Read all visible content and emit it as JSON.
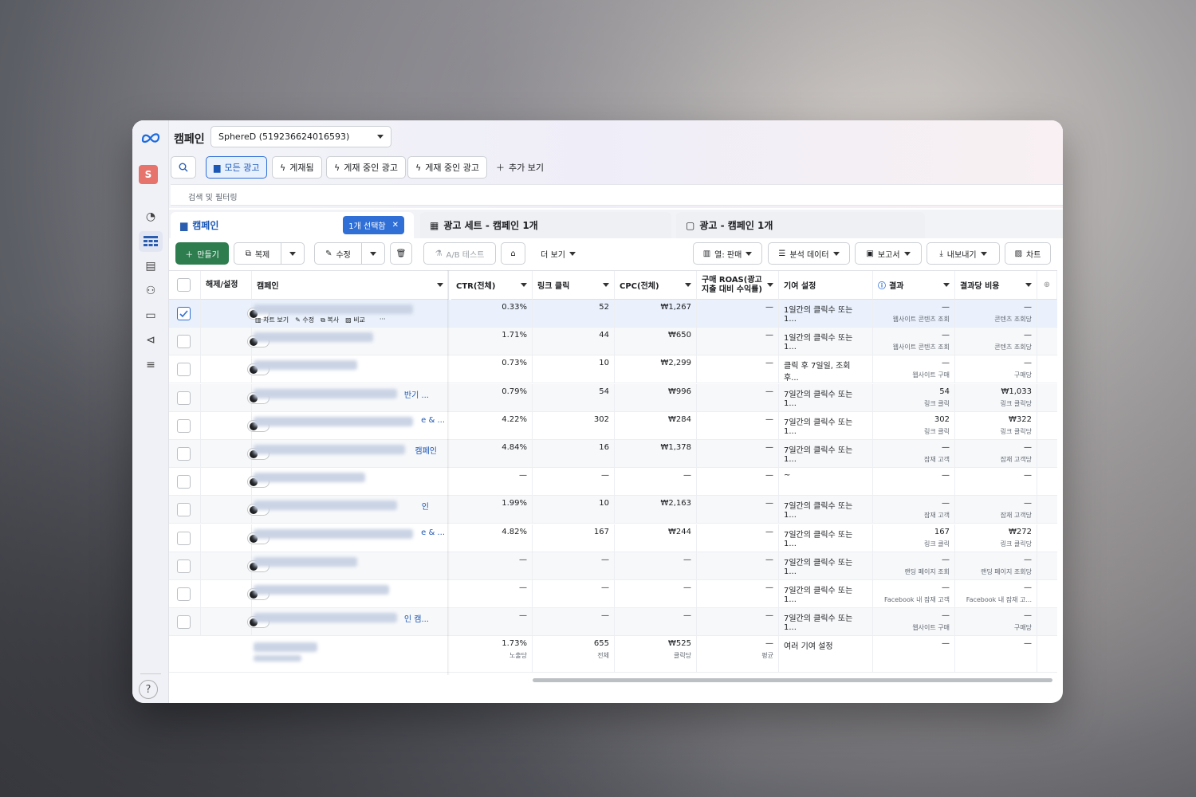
{
  "app": {
    "title": "캠페인",
    "account": "SphereD (519236624016593)",
    "avatar_letter": "S",
    "help": "?"
  },
  "filters": [
    {
      "label": "모든 광고",
      "active": true,
      "icon": "folder-icon"
    },
    {
      "label": "게재됨",
      "icon": "bolt-icon"
    },
    {
      "label": "게재 중인 광고",
      "icon": "bolt-icon"
    },
    {
      "label": "게재 중인 광고",
      "icon": "bolt-icon"
    },
    {
      "label": "추가 보기",
      "icon": "plus-icon"
    }
  ],
  "search_placeholder": "검색 및 필터링",
  "tabs": [
    {
      "label": "캠페인",
      "badge": "1개 선택함"
    },
    {
      "label": "광고 세트 - 캠페인 1개"
    },
    {
      "label": "광고 - 캠페인 1개"
    }
  ],
  "toolbar": {
    "create": "만들기",
    "duplicate": "복제",
    "edit": "수정",
    "ab_test": "A/B 테스트",
    "more": "더 보기",
    "columns": "열: 판매",
    "breakdown": "분석 데이터",
    "reports": "보고서",
    "export": "내보내기",
    "charts": "차트"
  },
  "columns": {
    "toggle": "해제/설정",
    "campaign": "캠페인",
    "ctr": "CTR(전체)",
    "link_clicks": "링크 클릭",
    "cpc": "CPC(전체)",
    "roas": "구매 ROAS(광고 지출 대비 수익률)",
    "attribution": "기여 설정",
    "results": "결과",
    "cost_per_result": "결과당 비용"
  },
  "row_actions": {
    "chart": "차트 보기",
    "edit": "수정",
    "duplicate": "복사",
    "compare": "비교",
    "more": "···"
  },
  "rows": [
    {
      "name_tail": "",
      "ctr": "0.33%",
      "clicks": "52",
      "cpc": "₩1,267",
      "roas": "—",
      "attr": "1일간의 클릭수 또는 1...",
      "result": "—",
      "result_sub": "웹사이트 콘텐츠 조회",
      "cost": "—",
      "cost_sub": "콘텐츠 조회당",
      "selected": true
    },
    {
      "name_tail": "",
      "ctr": "1.71%",
      "clicks": "44",
      "cpc": "₩650",
      "roas": "—",
      "attr": "1일간의 클릭수 또는 1...",
      "result": "—",
      "result_sub": "웹사이트 콘텐츠 조회",
      "cost": "—",
      "cost_sub": "콘텐츠 조회당"
    },
    {
      "name_tail": "",
      "ctr": "0.73%",
      "clicks": "10",
      "cpc": "₩2,299",
      "roas": "—",
      "attr": "클릭 후 7일일, 조회 후...",
      "result": "—",
      "result_sub": "웹사이트 구매",
      "cost": "—",
      "cost_sub": "구매당"
    },
    {
      "name_tail": "반기 ...",
      "ctr": "0.79%",
      "clicks": "54",
      "cpc": "₩996",
      "roas": "—",
      "attr": "7일간의 클릭수 또는 1...",
      "result": "54",
      "result_sub": "링크 클릭",
      "cost": "₩1,033",
      "cost_sub": "링크 클릭당"
    },
    {
      "name_tail": "e & ...",
      "ctr": "4.22%",
      "clicks": "302",
      "cpc": "₩284",
      "roas": "—",
      "attr": "7일간의 클릭수 또는 1...",
      "result": "302",
      "result_sub": "링크 클릭",
      "cost": "₩322",
      "cost_sub": "링크 클릭당"
    },
    {
      "name_tail": "캠페인",
      "ctr": "4.84%",
      "clicks": "16",
      "cpc": "₩1,378",
      "roas": "—",
      "attr": "7일간의 클릭수 또는 1...",
      "result": "—",
      "result_sub": "잠재 고객",
      "cost": "—",
      "cost_sub": "잠재 고객당"
    },
    {
      "name_tail": "",
      "ctr": "—",
      "clicks": "—",
      "cpc": "—",
      "roas": "—",
      "attr": "~",
      "result": "—",
      "result_sub": "",
      "cost": "—",
      "cost_sub": ""
    },
    {
      "name_tail": "인",
      "ctr": "1.99%",
      "clicks": "10",
      "cpc": "₩2,163",
      "roas": "—",
      "attr": "7일간의 클릭수 또는 1...",
      "result": "—",
      "result_sub": "잠재 고객",
      "cost": "—",
      "cost_sub": "잠재 고객당"
    },
    {
      "name_tail": "e & ...",
      "ctr": "4.82%",
      "clicks": "167",
      "cpc": "₩244",
      "roas": "—",
      "attr": "7일간의 클릭수 또는 1...",
      "result": "167",
      "result_sub": "링크 클릭",
      "cost": "₩272",
      "cost_sub": "링크 클릭당"
    },
    {
      "name_tail": "",
      "ctr": "—",
      "clicks": "—",
      "cpc": "—",
      "roas": "—",
      "attr": "7일간의 클릭수 또는 1...",
      "result": "—",
      "result_sub": "랜딩 페이지 조회",
      "cost": "—",
      "cost_sub": "랜딩 페이지 조회당"
    },
    {
      "name_tail": "",
      "ctr": "—",
      "clicks": "—",
      "cpc": "—",
      "roas": "—",
      "attr": "7일간의 클릭수 또는 1...",
      "result": "—",
      "result_sub": "Facebook 내 잠재 고객",
      "cost": "—",
      "cost_sub": "Facebook 내 잠재 고..."
    },
    {
      "name_tail": "인 캠...",
      "ctr": "—",
      "clicks": "—",
      "cpc": "—",
      "roas": "—",
      "attr": "7일간의 클릭수 또는 1...",
      "result": "—",
      "result_sub": "웹사이트 구매",
      "cost": "—",
      "cost_sub": "구매당"
    }
  ],
  "totals": {
    "ctr": "1.73%",
    "ctr_sub": "노출당",
    "clicks": "655",
    "clicks_sub": "전체",
    "cpc": "₩525",
    "cpc_sub": "클릭당",
    "roas": "—",
    "roas_sub": "평균",
    "attr": "여러 기여 설정",
    "result": "—",
    "cost": "—"
  }
}
